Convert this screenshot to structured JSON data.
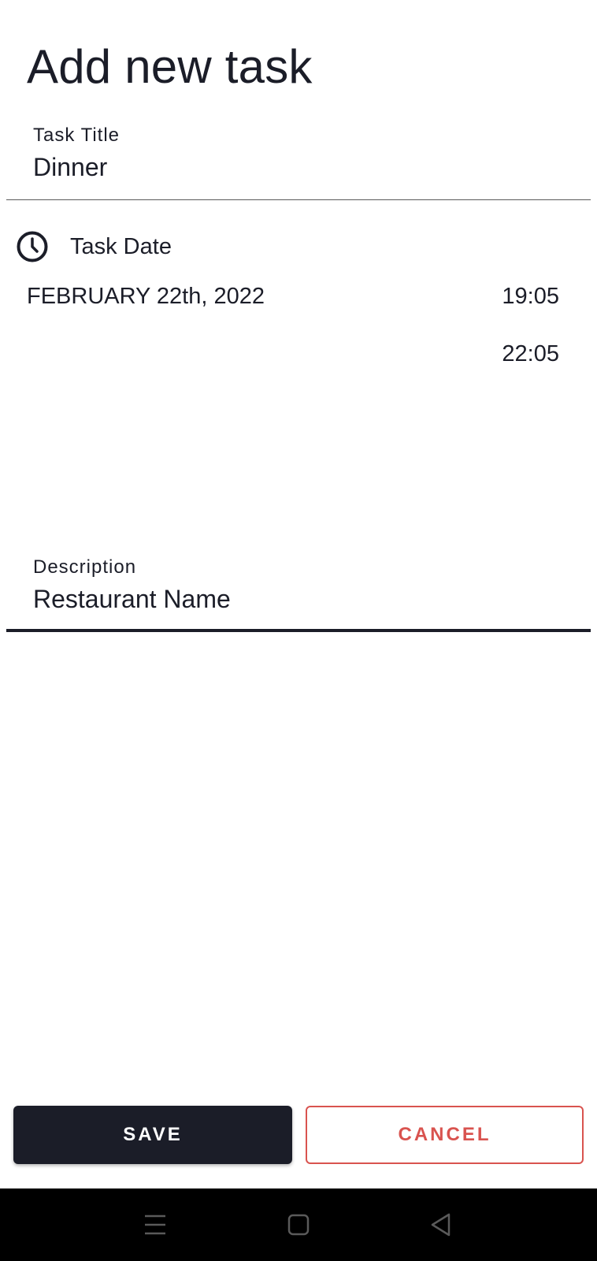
{
  "page": {
    "title": "Add new task"
  },
  "task_title": {
    "label": "Task Title",
    "value": "Dinner"
  },
  "task_date": {
    "label": "Task Date",
    "date": "FEBRUARY 22th, 2022",
    "start_time": "19:05",
    "end_time": "22:05",
    "icon": "clock-icon"
  },
  "description": {
    "label": "Description",
    "value": "Restaurant Name"
  },
  "actions": {
    "save_label": "SAVE",
    "cancel_label": "CANCEL"
  },
  "colors": {
    "primary": "#1b1d28",
    "cancel": "#d9534f",
    "nav_bar": "#000000"
  },
  "system_nav": {
    "icons": [
      "menu-icon",
      "home-icon",
      "back-icon"
    ]
  }
}
